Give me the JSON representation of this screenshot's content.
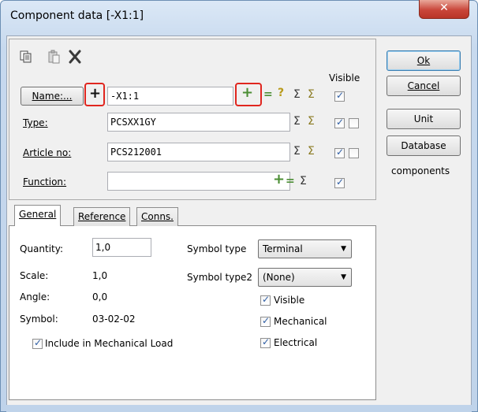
{
  "window": {
    "title": "Component data [-X1:1]",
    "close_glyph": "✕"
  },
  "toolbar": {
    "copy_icon": "copy-icon",
    "paste_icon": "paste-icon",
    "delete_icon": "delete-icon"
  },
  "fields": {
    "visible_header": "Visible",
    "name": {
      "button": "Name:...",
      "value": "-X1:1"
    },
    "type": {
      "label": "Type:",
      "value": "PCSXX1GY"
    },
    "article": {
      "label": "Article no:",
      "value": "PCS212001"
    },
    "function": {
      "label": "Function:",
      "value": ""
    }
  },
  "tabs": [
    "General",
    "Reference",
    "Conns."
  ],
  "general": {
    "quantity_label": "Quantity:",
    "quantity_value": "1,0",
    "scale_label": "Scale:",
    "scale_value": "1,0",
    "angle_label": "Angle:",
    "angle_value": "0,0",
    "symbol_label": "Symbol:",
    "symbol_value": "03-02-02",
    "include_mech": "Include in Mechanical Load",
    "symbol_type_label": "Symbol type",
    "symbol_type_value": "Terminal",
    "symbol_type2_label": "Symbol type2",
    "symbol_type2_value": "(None)",
    "visible": "Visible",
    "mechanical": "Mechanical",
    "electrical": "Electrical"
  },
  "buttons": {
    "ok": "Ok",
    "cancel": "Cancel",
    "unit": "Unit",
    "database": "Database"
  },
  "components_label": "components",
  "glyphs": {
    "plus": "+",
    "equals": "=",
    "question": "?",
    "sigma": "Σ",
    "sigma_check": "Σ"
  }
}
